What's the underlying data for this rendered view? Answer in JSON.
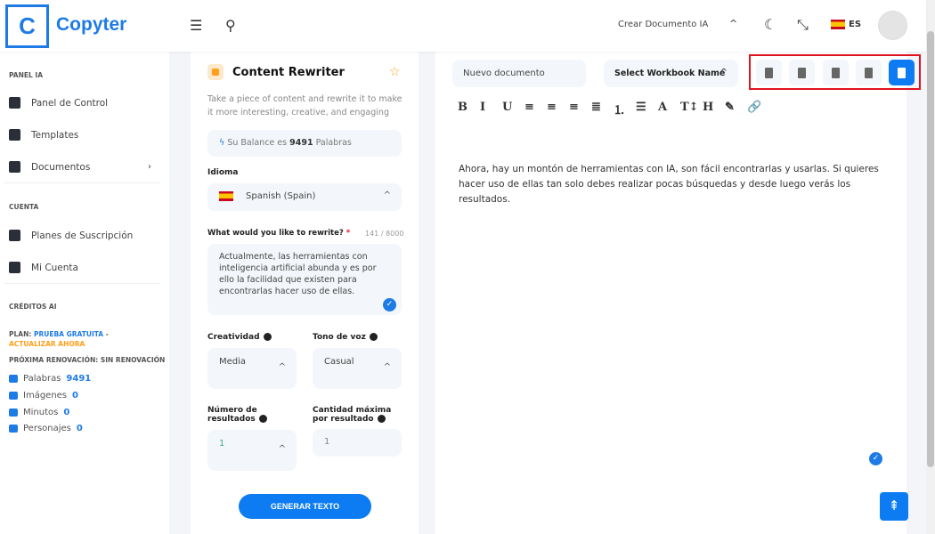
{
  "header": {
    "logo_letter": "C",
    "brand": "Copyter",
    "create_doc": "Crear Documento IA",
    "lang": "ES"
  },
  "sidebar": {
    "sections": {
      "panel": "PANEL IA",
      "cuenta": "CUENTA",
      "creditos": "CRÉDITOS AI"
    },
    "items": [
      {
        "label": "Panel de Control",
        "icon": "dashboard-icon"
      },
      {
        "label": "Templates",
        "icon": "ai-chip-icon"
      },
      {
        "label": "Documentos",
        "icon": "folder-icon"
      },
      {
        "label": "Planes de Suscripción",
        "icon": "subscription-icon"
      },
      {
        "label": "Mi Cuenta",
        "icon": "account-icon"
      }
    ],
    "plan_prefix": "PLAN:",
    "plan_name": "PRUEBA GRATUITA",
    "plan_sep": " - ",
    "plan_upgrade": "ACTUALIZAR AHORA",
    "renewal": "PRÓXIMA RENOVACIÓN: SIN RENOVACIÓN",
    "credits": [
      {
        "label": "Palabras",
        "value": "9491"
      },
      {
        "label": "Imágenes",
        "value": "0"
      },
      {
        "label": "Minutos",
        "value": "0"
      },
      {
        "label": "Personajes",
        "value": "0"
      }
    ]
  },
  "form": {
    "title": "Content Rewriter",
    "description": "Take a piece of content and rewrite it to make it more interesting, creative, and engaging",
    "balance_prefix": "Su Balance es ",
    "balance_value": "9491",
    "balance_suffix": " Palabras",
    "language_label": "Idioma",
    "language_value": "Spanish (Spain)",
    "text_label": "What would you like to rewrite?",
    "required_mark": "*",
    "char_count": "141 / 8000",
    "text_value": "Actualmente, las herramientas con inteligencia artificial abunda y es por ello la facilidad que existen para encontrarlas hacer uso de ellas.",
    "creativity_label": "Creatividad",
    "creativity_value": "Media",
    "tone_label": "Tono de voz",
    "tone_value": "Casual",
    "results_label": "Número de resultados",
    "results_value": "1",
    "max_label": "Cantidad máxima por resultado",
    "max_value": "1",
    "generate": "GENERAR TEXTO"
  },
  "editor": {
    "doc_name": "Nuevo documento",
    "workbook": "Select Workbook Name",
    "export_buttons": [
      "export-word-icon",
      "export-pdf-icon",
      "export-txt-icon",
      "copy-icon",
      "save-icon"
    ],
    "toolbar": [
      {
        "g": "B",
        "n": "bold"
      },
      {
        "g": "I",
        "n": "italic"
      },
      {
        "g": "U",
        "n": "underline"
      },
      {
        "g": "≡",
        "n": "align-left"
      },
      {
        "g": "≡",
        "n": "align-center"
      },
      {
        "g": "≡",
        "n": "align-right"
      },
      {
        "g": "≣",
        "n": "justify"
      },
      {
        "g": "⒈",
        "n": "ordered-list"
      },
      {
        "g": "☰",
        "n": "bullet-list"
      },
      {
        "g": "A",
        "n": "font-color"
      },
      {
        "g": "T↕",
        "n": "font-size"
      },
      {
        "g": "H",
        "n": "heading"
      },
      {
        "g": "✎",
        "n": "brush"
      },
      {
        "g": "🔗",
        "n": "link"
      }
    ],
    "content": "Ahora, hay un montón de herramientas con IA, son fácil encontrarlas y usarlas. Si quieres hacer uso de ellas tan solo debes realizar pocas búsquedas y desde luego verás los resultados."
  },
  "colors": {
    "accent": "#0d7cf2",
    "highlight": "#ff9f1a",
    "outline": "#e0141e"
  }
}
